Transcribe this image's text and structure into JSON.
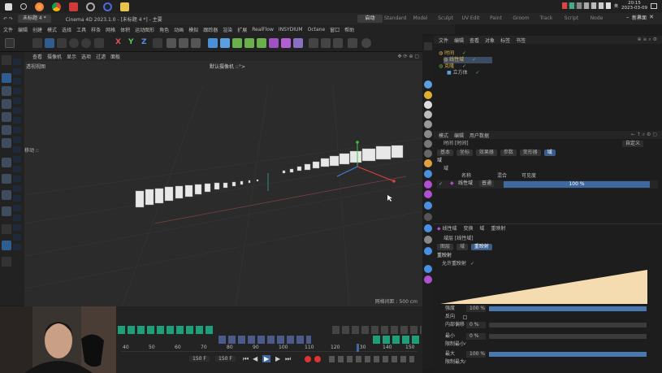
{
  "taskbar": {
    "time": "20:15",
    "date": "2023-03-09",
    "tray_label": "英",
    "icons": [
      "start-icon",
      "search-icon",
      "firefox-icon",
      "chrome-icon",
      "app-red-icon",
      "app-circle-icon",
      "cinema4d-icon",
      "folder-icon"
    ]
  },
  "window": {
    "doc_tab": "未标题 4 *",
    "title": "Cinema 4D 2023.1.0 - [未标题 4 *] - 主要",
    "layouts": [
      "启动",
      "Standard",
      "Model",
      "Sculpt",
      "UV Edit",
      "Paint",
      "Groom",
      "Track",
      "Script",
      "Node"
    ],
    "active_layout": "启动",
    "new_layout": "新界面"
  },
  "menu": [
    "文件",
    "编辑",
    "创建",
    "模式",
    "选择",
    "工具",
    "样条",
    "网格",
    "体积",
    "运动图形",
    "角色",
    "动画",
    "模拟",
    "跟踪器",
    "渲染",
    "扩展",
    "RealFlow",
    "INSYDIUM",
    "Octane",
    "窗口",
    "帮助"
  ],
  "toolbar": {
    "axes": [
      "X",
      "Y",
      "Z"
    ]
  },
  "viewport": {
    "menu": [
      "查看",
      "摄像机",
      "显示",
      "选项",
      "过滤",
      "面板"
    ],
    "camera_label": "默认摄像机 ::°>",
    "view_name": "透视视图",
    "move_label": "移动 ::",
    "grid_spacing": "网格间距 : 500 cm"
  },
  "objects": {
    "tabs": [
      "文件",
      "编辑",
      "查看",
      "对象",
      "标签",
      "书签"
    ],
    "items": [
      {
        "name": "时间",
        "color": "#e0b050"
      },
      {
        "name": "线性域",
        "color": "#e0b050"
      },
      {
        "name": "克隆",
        "color": "#e0b050"
      },
      {
        "name": "立方体",
        "color": "#bbbbbb"
      }
    ]
  },
  "attributes": {
    "tabs": [
      "模式",
      "编辑",
      "用户数据"
    ],
    "mode_label": "自定义",
    "object_name": "时间 [时间]",
    "subtabs": [
      "基本",
      "坐标",
      "效果器",
      "参数",
      "变形器",
      "域"
    ],
    "active_subtab": "域",
    "section": "域",
    "subsection": "域",
    "field_cols": [
      "名称",
      "混合",
      "可见度"
    ],
    "field_row": {
      "name": "线性域",
      "blend": "普通",
      "value": "100 %"
    },
    "linear_field": {
      "title": "线性域",
      "header_items": [
        "变换",
        "域",
        "重映射"
      ],
      "object_label": "域层 [线性域]",
      "subtabs": [
        "图层",
        "域",
        "重映射"
      ],
      "active_subtab": "重映射",
      "section": "重映射",
      "enable_label": "允许重映射"
    },
    "params": [
      {
        "label": "强度",
        "value": "100 %"
      },
      {
        "label": "反向",
        "value": ""
      },
      {
        "label": "内部偏移",
        "value": "0 %"
      },
      {
        "label": "最小",
        "value": "0 %"
      },
      {
        "label": "限制最小",
        "value": ""
      },
      {
        "label": "最大",
        "value": "100 %"
      },
      {
        "label": "限制最大",
        "value": ""
      }
    ]
  },
  "timeline": {
    "ticks": [
      "40",
      "50",
      "60",
      "70",
      "80",
      "90",
      "100",
      "110",
      "120",
      "130",
      "140",
      "150"
    ],
    "start_frame": "150 F",
    "end_frame": "150 F"
  }
}
